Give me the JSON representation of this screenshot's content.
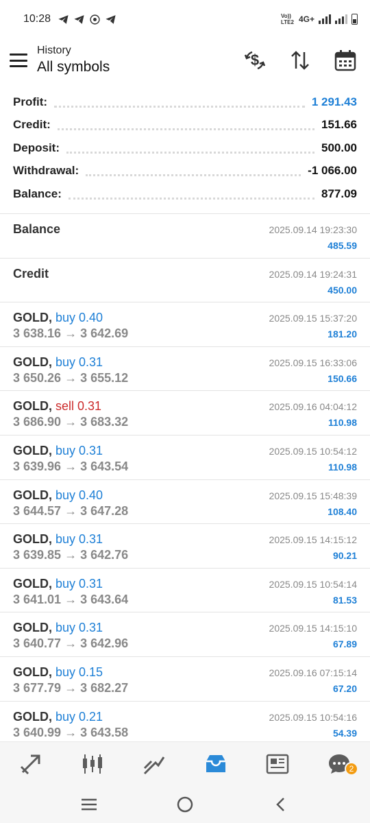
{
  "status_bar": {
    "time": "10:28",
    "left_icons": [
      "telegram-icon",
      "telegram-icon",
      "chrome-icon",
      "telegram-icon"
    ],
    "volte": "Vo)) LTE2",
    "network": "4G+"
  },
  "header": {
    "subtitle": "History",
    "title": "All symbols",
    "actions": [
      "deposit-icon",
      "sort-icon",
      "calendar-icon"
    ]
  },
  "summary": [
    {
      "label": "Profit:",
      "value": "1 291.43",
      "highlight": true
    },
    {
      "label": "Credit:",
      "value": "151.66",
      "highlight": false
    },
    {
      "label": "Deposit:",
      "value": "500.00",
      "highlight": false
    },
    {
      "label": "Withdrawal:",
      "value": "-1 066.00",
      "highlight": false
    },
    {
      "label": "Balance:",
      "value": "877.09",
      "highlight": false
    }
  ],
  "operations": [
    {
      "title": "Balance",
      "date": "2025.09.14 19:23:30",
      "amount": "485.59"
    },
    {
      "title": "Credit",
      "date": "2025.09.14 19:24:31",
      "amount": "450.00"
    }
  ],
  "deals": [
    {
      "symbol": "GOLD,",
      "direction": "buy 0.40",
      "type": "buy",
      "open": "3 638.16",
      "arrow": "→",
      "close": "3 642.69",
      "date": "2025.09.15 15:37:20",
      "profit": "181.20"
    },
    {
      "symbol": "GOLD,",
      "direction": "buy 0.31",
      "type": "buy",
      "open": "3 650.26",
      "arrow": "→",
      "close": "3 655.12",
      "date": "2025.09.15 16:33:06",
      "profit": "150.66"
    },
    {
      "symbol": "GOLD,",
      "direction": "sell 0.31",
      "type": "sell",
      "open": "3 686.90",
      "arrow": "→",
      "close": "3 683.32",
      "date": "2025.09.16 04:04:12",
      "profit": "110.98"
    },
    {
      "symbol": "GOLD,",
      "direction": "buy 0.31",
      "type": "buy",
      "open": "3 639.96",
      "arrow": "→",
      "close": "3 643.54",
      "date": "2025.09.15 10:54:12",
      "profit": "110.98"
    },
    {
      "symbol": "GOLD,",
      "direction": "buy 0.40",
      "type": "buy",
      "open": "3 644.57",
      "arrow": "→",
      "close": "3 647.28",
      "date": "2025.09.15 15:48:39",
      "profit": "108.40"
    },
    {
      "symbol": "GOLD,",
      "direction": "buy 0.31",
      "type": "buy",
      "open": "3 639.85",
      "arrow": "→",
      "close": "3 642.76",
      "date": "2025.09.15 14:15:12",
      "profit": "90.21"
    },
    {
      "symbol": "GOLD,",
      "direction": "buy 0.31",
      "type": "buy",
      "open": "3 641.01",
      "arrow": "→",
      "close": "3 643.64",
      "date": "2025.09.15 10:54:14",
      "profit": "81.53"
    },
    {
      "symbol": "GOLD,",
      "direction": "buy 0.31",
      "type": "buy",
      "open": "3 640.77",
      "arrow": "→",
      "close": "3 642.96",
      "date": "2025.09.15 14:15:10",
      "profit": "67.89"
    },
    {
      "symbol": "GOLD,",
      "direction": "buy 0.15",
      "type": "buy",
      "open": "3 677.79",
      "arrow": "→",
      "close": "3 682.27",
      "date": "2025.09.16 07:15:14",
      "profit": "67.20"
    },
    {
      "symbol": "GOLD,",
      "direction": "buy 0.21",
      "type": "buy",
      "open": "3 640.99",
      "arrow": "→",
      "close": "3 643.58",
      "date": "2025.09.15 10:54:16",
      "profit": "54.39"
    }
  ],
  "bottom_nav": {
    "items": [
      "quotes-icon",
      "chart-icon",
      "trade-icon",
      "history-icon",
      "news-icon",
      "chat-icon"
    ],
    "active": "history-icon",
    "chat_badge": "2"
  },
  "system_nav": [
    "recents-icon",
    "home-icon",
    "back-icon"
  ],
  "colors": {
    "accent": "#1d7fd6",
    "sell": "#cc2b2b",
    "muted": "#888888",
    "badge": "#f39c12"
  }
}
